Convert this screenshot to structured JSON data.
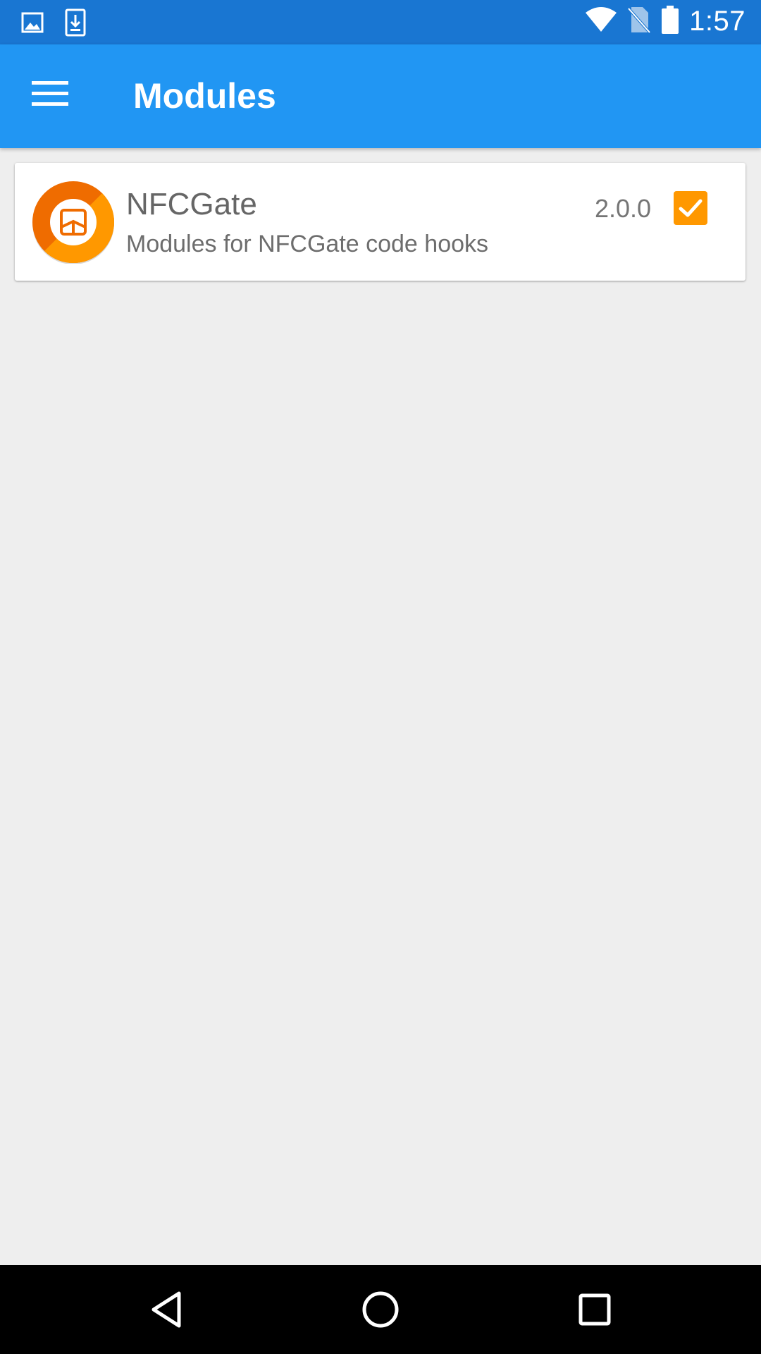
{
  "status_bar": {
    "time": "1:57",
    "left_icons": [
      "image-notification-icon",
      "download-notification-icon"
    ],
    "right_icons": [
      "wifi-icon",
      "no-sim-icon",
      "battery-icon"
    ]
  },
  "app_bar": {
    "title": "Modules",
    "background": "#2196f3",
    "menu_icon": "menu-icon"
  },
  "modules": [
    {
      "name": "NFCGate",
      "description": "Modules for NFCGate code hooks",
      "version": "2.0.0",
      "enabled": true,
      "icon": "nfcgate-app-icon",
      "accent": "#ff9800"
    }
  ],
  "nav_bar": {
    "icons": [
      "back-icon",
      "home-icon",
      "recents-icon"
    ]
  }
}
